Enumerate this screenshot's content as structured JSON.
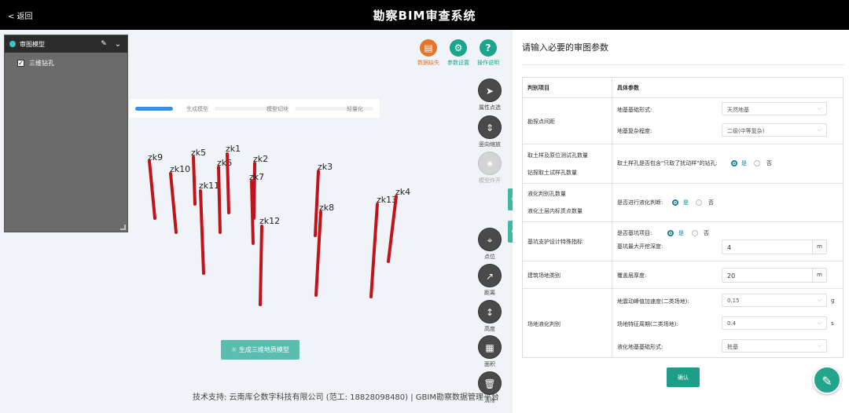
{
  "header": {
    "back_label": "< 返回",
    "title": "勘察BIM审查系统"
  },
  "model_panel": {
    "title": "审图模型",
    "items": [
      {
        "label": "三维钻孔",
        "checked": true
      }
    ]
  },
  "progress": {
    "steps": [
      {
        "label": "生成模型",
        "fraction": 1.0
      },
      {
        "label": "模型切块",
        "fraction": 0.0
      },
      {
        "label": "轻量化",
        "fraction": 0.0
      }
    ],
    "accent": "#3a8ee6"
  },
  "top_tools": [
    {
      "name": "data-missing",
      "label": "数据缺失",
      "color": "#e8742a",
      "glyph": "▤"
    },
    {
      "name": "param-settings",
      "label": "参数设置",
      "color": "#1aa58d",
      "glyph": "⚙"
    },
    {
      "name": "help",
      "label": "操作说明",
      "color": "#1aa58d",
      "glyph": "?"
    }
  ],
  "side_tools": [
    {
      "name": "attribute-pick",
      "label": "属性点选",
      "glyph": "➤",
      "disabled": false
    },
    {
      "name": "vertical-zoom",
      "label": "竖向缩放",
      "glyph": "⇕",
      "disabled": false
    },
    {
      "name": "model-explode",
      "label": "模型炸开",
      "glyph": "✷",
      "disabled": true
    },
    {
      "name": "point",
      "label": "点位",
      "glyph": "⌖",
      "disabled": false
    },
    {
      "name": "distance",
      "label": "距离",
      "glyph": "↗",
      "disabled": false
    },
    {
      "name": "height",
      "label": "高度",
      "glyph": "↕",
      "disabled": false
    },
    {
      "name": "area",
      "label": "面积",
      "glyph": "▦",
      "disabled": false
    },
    {
      "name": "clear",
      "label": "清除",
      "glyph": "🗑",
      "disabled": false
    }
  ],
  "boreholes": [
    {
      "label": "zk9"
    },
    {
      "label": "zk10"
    },
    {
      "label": "zk5"
    },
    {
      "label": "zk11"
    },
    {
      "label": "zk6"
    },
    {
      "label": "zk1"
    },
    {
      "label": "zk2"
    },
    {
      "label": "zk7"
    },
    {
      "label": "zk12"
    },
    {
      "label": "zk3"
    },
    {
      "label": "zk8"
    },
    {
      "label": "zk13"
    },
    {
      "label": "zk4"
    }
  ],
  "generate_button": "☼ 生成三维地质模型",
  "footer": "技术支持: 云南库仑数字科技有限公司  (范工: 18828098480)  | GBIM勘察数据管理平台",
  "params": {
    "title": "请输入必要的审图参数",
    "col_item": "判别项目",
    "col_param": "具体参数",
    "rows": {
      "spacing": {
        "item": "勘探点间距",
        "foundation_label": "地基基础形式:",
        "foundation_value": "天然地基",
        "complexity_label": "地基复杂程度:",
        "complexity_value": "二级(中等复杂)"
      },
      "sampling": {
        "item1": "取土样及原位测试孔数量",
        "item2": "钻探取土试样孔数量",
        "question": "取土样孔是否包含\"只取了扰动样\"的钻孔:",
        "yes": "是",
        "no": "否"
      },
      "liquefaction": {
        "item1": "液化判别孔数量",
        "item2": "液化土层内标贯点数量",
        "question": "是否进行液化判断:",
        "yes": "是",
        "no": "否"
      },
      "pit": {
        "item": "基坑支护设计特殊指标",
        "question": "是否基坑项目:",
        "yes": "是",
        "no": "否",
        "depth_label": "基坑最大开挖深度:",
        "depth_value": "4",
        "depth_unit": "m"
      },
      "site": {
        "item": "建筑场地类别",
        "cover_label": "覆盖层厚度:",
        "cover_value": "20",
        "cover_unit": "m"
      },
      "site_liq": {
        "item": "场地液化判别",
        "accel_label": "地震动峰值加速度(二类场地):",
        "accel_value": "0.15",
        "accel_unit": "g",
        "period_label": "场地特征周期(二类场地):",
        "period_value": "0.4",
        "period_unit": "s",
        "liq_found_label": "液化地基基础形式:",
        "liq_found_value": "桩基"
      }
    },
    "confirm": "确认"
  },
  "colors": {
    "borehole": "#c0141a",
    "accent": "#1e9e86"
  }
}
